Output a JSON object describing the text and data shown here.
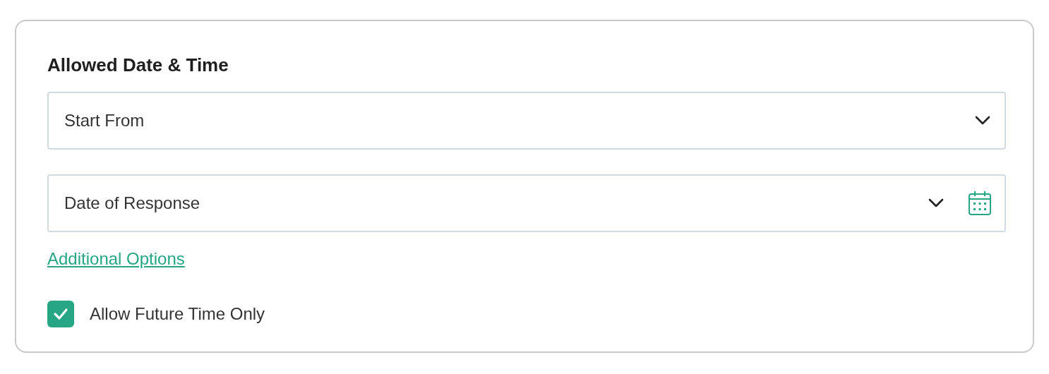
{
  "section": {
    "title": "Allowed Date & Time"
  },
  "fields": [
    {
      "kind": "select",
      "value": "Start From"
    },
    {
      "kind": "date",
      "value": "Date of Response"
    }
  ],
  "link": "Additional Options",
  "checkbox": {
    "label": "Allow Future Time Only",
    "checked": true
  }
}
